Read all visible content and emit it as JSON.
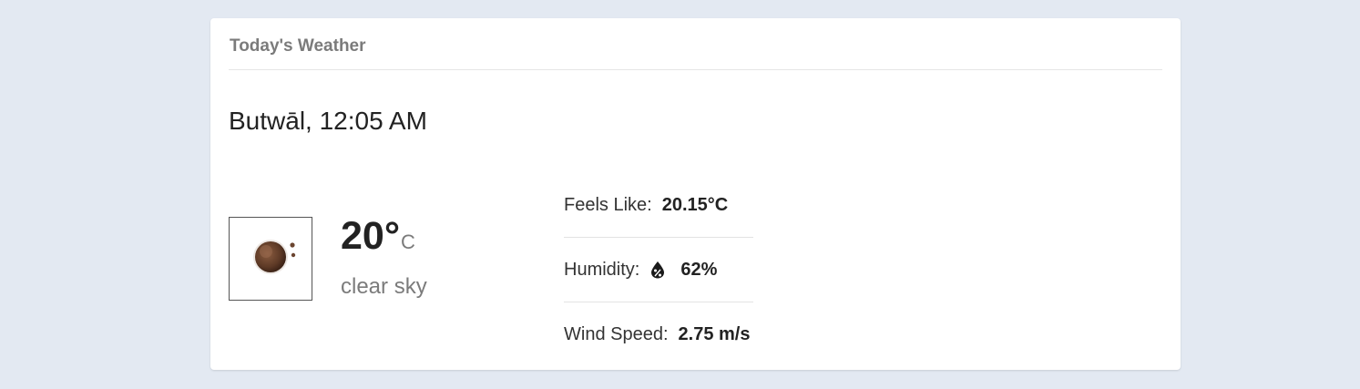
{
  "card": {
    "title": "Today's Weather"
  },
  "location": {
    "text": "Butwāl, 12:05 AM"
  },
  "current": {
    "temperature": "20°",
    "unit": "C",
    "description": "clear sky",
    "icon": "night-clear-moon-icon"
  },
  "details": {
    "feels_like_label": "Feels Like:",
    "feels_like_value": "20.15°C",
    "humidity_label": "Humidity:",
    "humidity_icon": "humidity-drop-icon",
    "humidity_value": "62%",
    "wind_label": "Wind Speed:",
    "wind_value": "2.75 m/s"
  },
  "colors": {
    "page_background": "#e3e9f2",
    "card_background": "#ffffff",
    "muted_text": "#7b7b7b",
    "moon": "#6b4530"
  }
}
